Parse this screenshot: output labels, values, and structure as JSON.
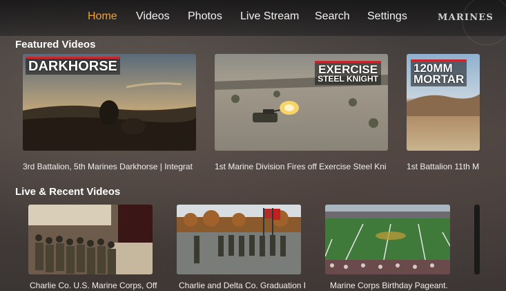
{
  "nav": {
    "items": [
      {
        "label": "Home",
        "active": true
      },
      {
        "label": "Videos",
        "active": false
      },
      {
        "label": "Photos",
        "active": false
      },
      {
        "label": "Live Stream",
        "active": false
      },
      {
        "label": "Search",
        "active": false
      },
      {
        "label": "Settings",
        "active": false
      }
    ],
    "brand": "MARINES",
    "active_color": "#f0a23a"
  },
  "featured": {
    "title": "Featured Videos",
    "cards": [
      {
        "thumb_title": "DARKHORSE",
        "caption": "3rd Battalion, 5th Marines Darkhorse | Integrat"
      },
      {
        "thumb_title_line1": "EXERCISE",
        "thumb_title_line2": "STEEL KNIGHT",
        "caption": "1st Marine Division Fires off Exercise Steel Kni"
      },
      {
        "thumb_title_line1": "120MM",
        "thumb_title_line2": "MORTAR",
        "caption": "1st Battalion 11th M"
      }
    ]
  },
  "recent": {
    "title": "Live & Recent Videos",
    "cards": [
      {
        "caption": "Charlie Co. U.S. Marine Corps, Off"
      },
      {
        "caption": "Charlie and Delta Co. Graduation F"
      },
      {
        "caption": "Marine Corps Birthday Pageant."
      }
    ]
  },
  "colors": {
    "accent_red": "#c8282d"
  }
}
